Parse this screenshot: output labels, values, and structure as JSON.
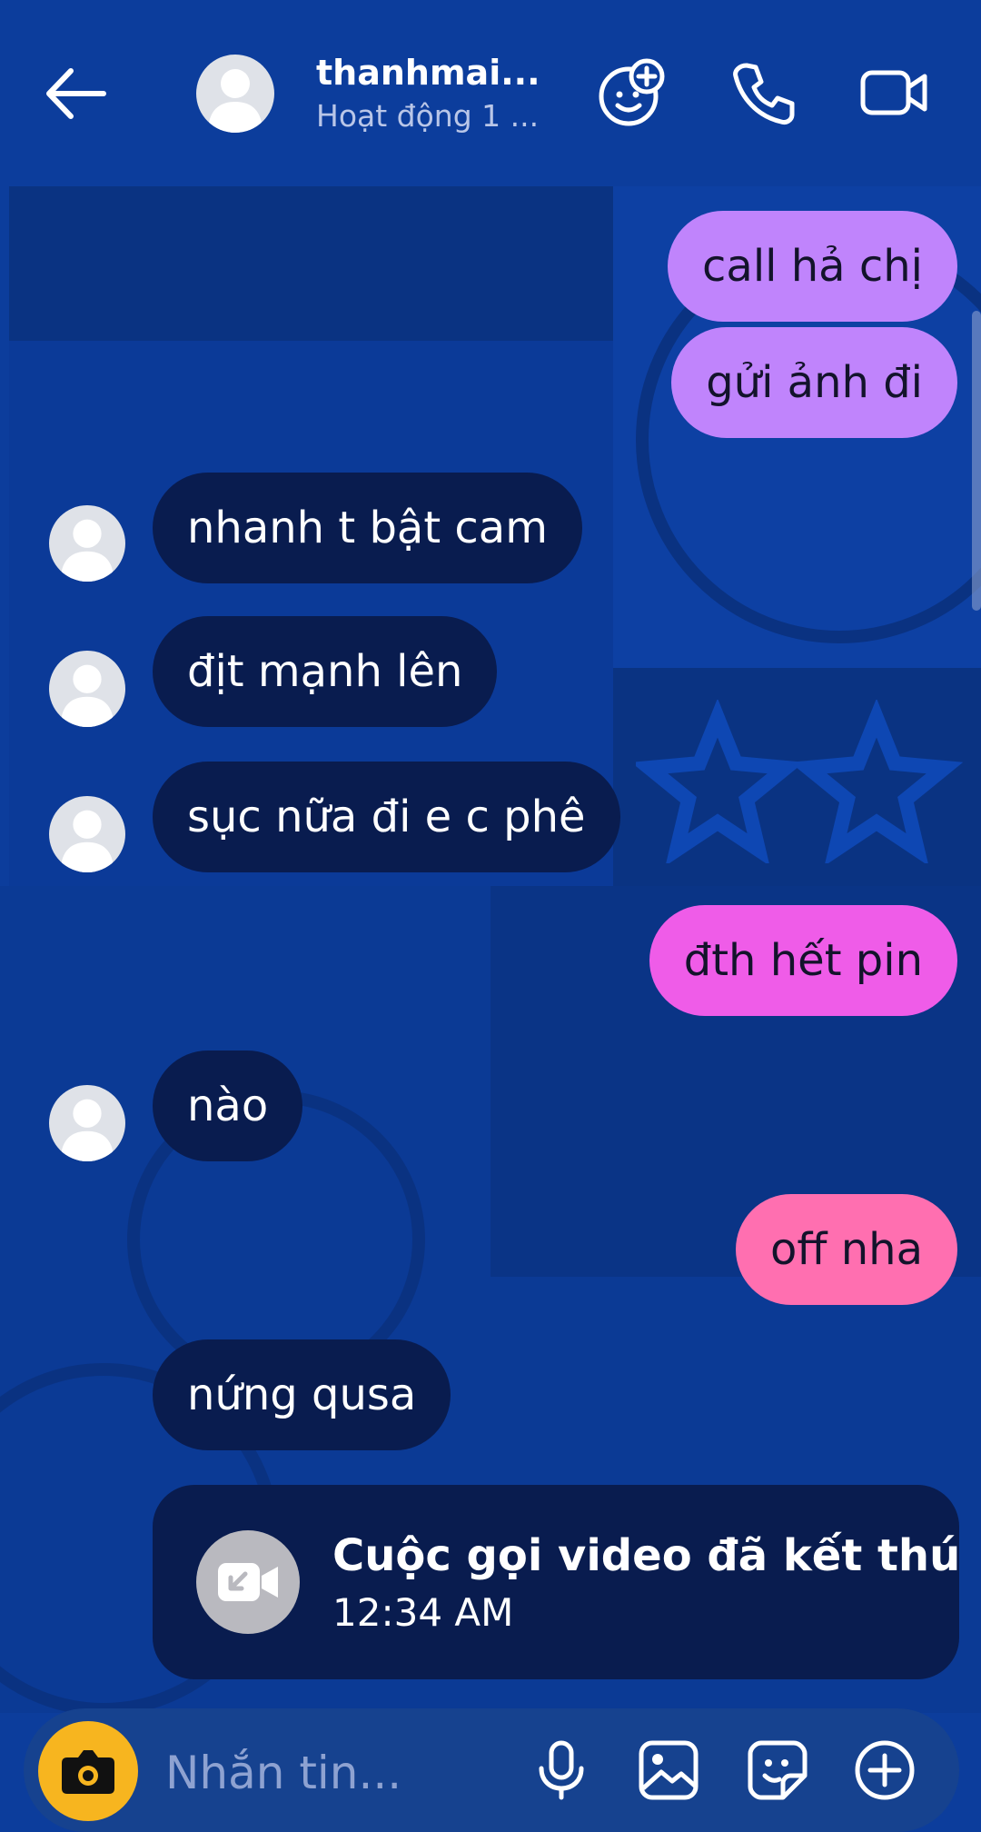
{
  "header": {
    "name": "thanhmai...",
    "status": "Hoạt động 1 ..."
  },
  "messages": [
    {
      "type": "sent",
      "text": "call hả chị",
      "color": "#c084fc"
    },
    {
      "type": "sent",
      "text": "gửi ảnh đi",
      "color": "#c084fc"
    },
    {
      "type": "received",
      "text": "nhanh t bật cam"
    },
    {
      "type": "received",
      "text": "địt mạnh lên"
    },
    {
      "type": "received",
      "text": "sục nữa đi e c phê"
    },
    {
      "type": "sent",
      "text": "đth hết pin",
      "color": "#ef5ce8"
    },
    {
      "type": "received",
      "text": "nào"
    },
    {
      "type": "sent",
      "text": "off nha",
      "color": "#ff6fb0"
    },
    {
      "type": "received",
      "text": "nứng qusa"
    }
  ],
  "call_card": {
    "title": "Cuộc gọi video đã kết thú",
    "time": "12:34 AM"
  },
  "composer": {
    "placeholder": "Nhắn tin..."
  },
  "icons": {
    "back": "arrow-left-icon",
    "games": "games-icon",
    "call": "phone-icon",
    "video": "video-camera-icon",
    "camera": "camera-icon",
    "mic": "microphone-icon",
    "gallery": "image-icon",
    "sticker": "sticker-icon",
    "plus": "plus-circle-icon"
  }
}
